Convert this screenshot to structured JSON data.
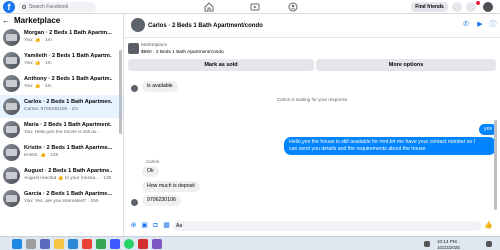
{
  "topbar": {
    "search_placeholder": "Search Facebook",
    "find_friends": "Find friends"
  },
  "sidebar": {
    "title": "Marketplace",
    "conversations": [
      {
        "name": "Morgan · 2 Beds 1 Bath Apartm...",
        "preview": "You: 👍 · 1m"
      },
      {
        "name": "Yamileth · 2 Beds 1 Bath Apartm...",
        "preview": "You: 👍 · 1m"
      },
      {
        "name": "Anthony · 2 Beds 1 Bath Apartm...",
        "preview": "You: 👍 · 1m"
      },
      {
        "name": "Carlos · 2 Beds 1 Bath Apartmen...",
        "preview": "Carlos: 9706230106 · 2m"
      },
      {
        "name": "Maria · 2 Beds 1 Bath Apartment...",
        "preview": "You: Hello,yes the house is still av..."
      },
      {
        "name": "Kristin · 2 Beds 1 Bath Apartme...",
        "preview": "Kristin: 👍 · 13h"
      },
      {
        "name": "August · 2 Beds 1 Bath Apartme...",
        "preview": "August reacted 👍 to your messa... · 13h"
      },
      {
        "name": "Garcia · 2 Beds 1 Bath Apartme...",
        "preview": "You: Yes, are you interested? · 15h"
      }
    ]
  },
  "chat": {
    "title": "Carlos · 2 Beds 1 Bath Apartment/condo",
    "listing_label": "Marketplace",
    "listing_detail": "$950 · 2 Beds 1 Bath Apartment/condo",
    "mark_sold": "Mark as sold",
    "more_options": "More options",
    "messages": {
      "m1": "is available",
      "system": "Carlos is waiting for your response",
      "m2": "yes",
      "m3_line1": "Hello,yes the house is still available for rent,let me have your contact number so I",
      "m3_line2": "can send you details and the requirements about the house",
      "sender": "Carlos",
      "m4": "Ok",
      "m5": "How much is deposit",
      "m6": "9706230106"
    },
    "composer_value": "Aa"
  },
  "taskbar": {
    "time": "10:14 PM",
    "date": "10/23/2025"
  },
  "colors": {
    "brand": "#1877f2",
    "outgoing_bubble": "#0084ff",
    "active_row": "#e7f3ff"
  }
}
